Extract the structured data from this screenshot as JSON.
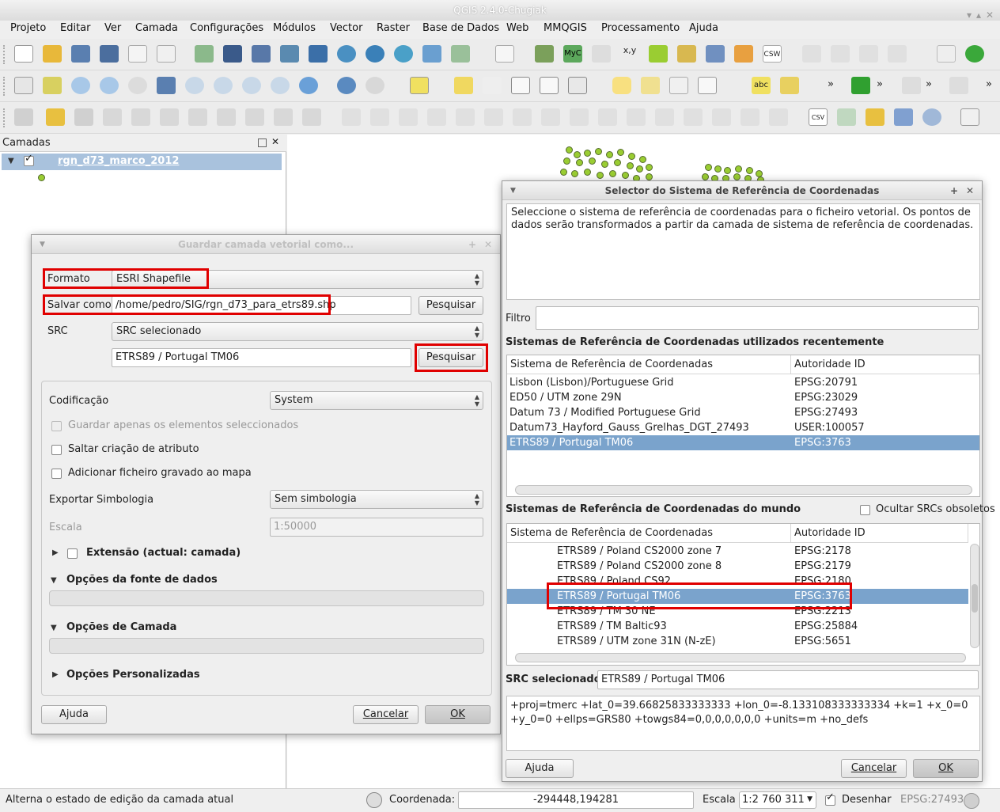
{
  "app": {
    "title": "QGIS 2.4.0-Chugiak",
    "win_min": "▾",
    "win_max": "▴",
    "win_close": "✕"
  },
  "menu": [
    "Projeto",
    "Editar",
    "Ver",
    "Camada",
    "Configurações",
    "Módulos",
    "Vector",
    "Raster",
    "Base de Dados",
    "Web",
    "MMQGIS",
    "Processamento",
    "Ajuda"
  ],
  "toolbar_text": {
    "myc": "MyC",
    "xy": "x,y",
    "csw": "CSW",
    "abc": "abc",
    "csv": "CSV",
    "chev": "»"
  },
  "layers": {
    "title": "Camadas",
    "items": [
      {
        "name": "rgn_d73_marco_2012"
      }
    ]
  },
  "save_dialog": {
    "title": "Guardar camada vetorial como...",
    "format_label": "Formato",
    "format_value": "ESRI Shapefile",
    "save_as_label": "Salvar como",
    "save_as_value": "/home/pedro/SIG/rgn_d73_para_etrs89.shp",
    "browse1": "Pesquisar",
    "src_label": "SRC",
    "src_mode": "SRC selecionado",
    "src_value": "ETRS89 / Portugal TM06",
    "browse2": "Pesquisar",
    "encoding_label": "Codificação",
    "encoding_value": "System",
    "opt_selected": "Guardar apenas os elementos seleccionados",
    "opt_skip_attr": "Saltar criação de atributo",
    "opt_add_map": "Adicionar ficheiro gravado ao mapa",
    "symbology_label": "Exportar Simbologia",
    "symbology_value": "Sem simbologia",
    "scale_label": "Escala",
    "scale_value": "1:50000",
    "extent_label": "Extensão (actual: camada)",
    "ds_options": "Opções da fonte de dados",
    "layer_options": "Opções de Camada",
    "custom_options": "Opções Personalizadas",
    "help": "Ajuda",
    "cancel": "Cancelar",
    "ok": "OK"
  },
  "crs_dialog": {
    "title": "Selector do Sistema de Referência de Coordenadas",
    "description": "Seleccione o sistema de referência de coordenadas para o ficheiro vetorial. Os pontos de dados serão transformados a partir da camada de sistema de referência de coordenadas.",
    "filter_label": "Filtro",
    "recent_title": "Sistemas de Referência de Coordenadas utilizados recentemente",
    "col_crs": "Sistema de Referência de Coordenadas",
    "col_auth": "Autoridade ID",
    "recent": [
      {
        "name": "Lisbon (Lisbon)/Portuguese Grid",
        "id": "EPSG:20791"
      },
      {
        "name": "ED50 / UTM zone 29N",
        "id": "EPSG:23029"
      },
      {
        "name": "Datum 73 / Modified Portuguese Grid",
        "id": "EPSG:27493"
      },
      {
        "name": "Datum73_Hayford_Gauss_Grelhas_DGT_27493",
        "id": "USER:100057"
      },
      {
        "name": "ETRS89 / Portugal TM06",
        "id": "EPSG:3763"
      }
    ],
    "world_title": "Sistemas de Referência de Coordenadas do mundo",
    "hide_obsolete": "Ocultar SRCs obsoletos",
    "world": [
      {
        "name": "ETRS89 / Poland CS2000 zone 7",
        "id": "EPSG:2178"
      },
      {
        "name": "ETRS89 / Poland CS2000 zone 8",
        "id": "EPSG:2179"
      },
      {
        "name": "ETRS89 / Poland CS92",
        "id": "EPSG:2180"
      },
      {
        "name": "ETRS89 / Portugal TM06",
        "id": "EPSG:3763"
      },
      {
        "name": "ETRS89 / TM 30 NE",
        "id": "EPSG:2213"
      },
      {
        "name": "ETRS89 / TM Baltic93",
        "id": "EPSG:25884"
      },
      {
        "name": "ETRS89 / UTM zone 31N (N-zE)",
        "id": "EPSG:5651"
      }
    ],
    "selected_label": "SRC selecionado:",
    "selected_value": "ETRS89 / Portugal TM06",
    "proj": "+proj=tmerc +lat_0=39.66825833333333 +lon_0=-8.133108333333334 +k=1 +x_0=0 +y_0=0 +ellps=GRS80 +towgs84=0,0,0,0,0,0,0 +units=m +no_defs",
    "help": "Ajuda",
    "cancel": "Cancelar",
    "ok": "OK"
  },
  "status": {
    "message": "Alterna o estado de edição da camada atual",
    "coord_label": "Coordenada:",
    "coord_value": "-294448,194281",
    "scale_label": "Escala",
    "scale_value": "1:2 760 311",
    "render_label": "Desenhar",
    "epsg": "EPSG:27493"
  }
}
